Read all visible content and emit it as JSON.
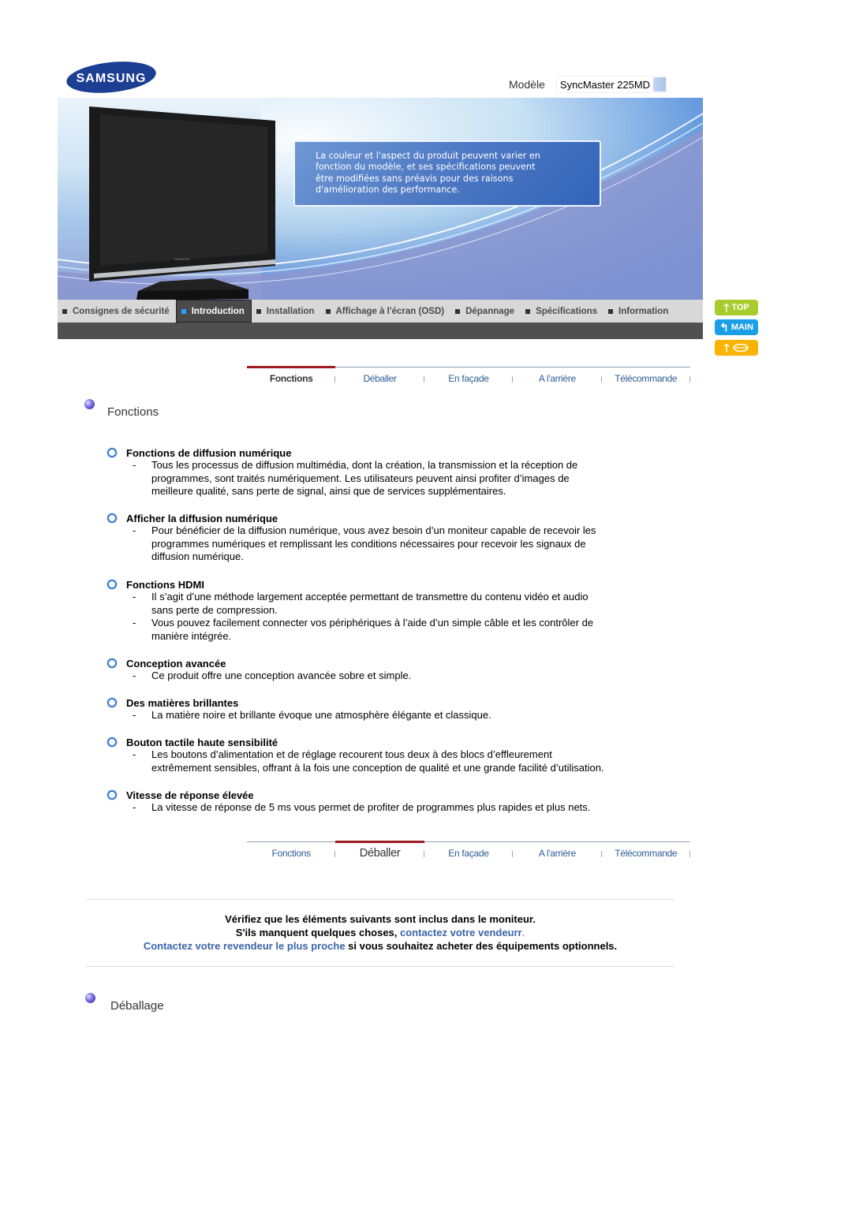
{
  "brand": {
    "logo_text": "SAMSUNG"
  },
  "model": {
    "label": "Modèle",
    "value": "SyncMaster 225MD"
  },
  "banner": {
    "notice_lines": [
      "La couleur et l'aspect du produit peuvent varier en",
      "fonction du modèle, et ses spécifications peuvent",
      "être modifiées sans préavis pour des raisons",
      "d'amélioration des performance."
    ]
  },
  "main_nav": {
    "items": [
      {
        "label": "Consignes de sécurité",
        "active": false
      },
      {
        "label": "Introduction",
        "active": true
      },
      {
        "label": "Installation",
        "active": false
      },
      {
        "label": "Affichage à l'écran (OSD)",
        "active": false
      },
      {
        "label": "Dépannage",
        "active": false
      },
      {
        "label": "Spécifications",
        "active": false
      },
      {
        "label": "Information",
        "active": false
      }
    ]
  },
  "side_buttons": {
    "top": "TOP",
    "main": "MAIN",
    "print_icon": "glasses-icon",
    "colors": {
      "top": "#a8cc2e",
      "main": "#1a9fe6",
      "print": "#f8b400"
    }
  },
  "subtabs_top": {
    "active_index": 0,
    "items": [
      "Fonctions",
      "Déballer",
      "En façade",
      "A l'arrière",
      "Télécommande"
    ]
  },
  "subtabs_bottom": {
    "active_index": 1,
    "items": [
      "Fonctions",
      "Déballer",
      "En façade",
      "A l'arrière",
      "Télécommande"
    ]
  },
  "section_fonctions": {
    "title": "Fonctions",
    "features": [
      {
        "title": "Fonctions de diffusion numérique",
        "items": [
          [
            "Tous les processus de diffusion multimédia, dont la création, la transmission et la réception de",
            "programmes, sont traités numériquement. Les utilisateurs peuvent ainsi profiter d’images de",
            "meilleure qualité, sans perte de signal, ainsi que de services supplémentaires."
          ]
        ]
      },
      {
        "title": "Afficher la diffusion numérique",
        "items": [
          [
            "Pour bénéficier de la diffusion numérique, vous avez besoin d’un moniteur capable de recevoir les",
            "programmes numériques et remplissant les conditions nécessaires pour recevoir les signaux de",
            "diffusion numérique."
          ]
        ]
      },
      {
        "title": "Fonctions HDMI",
        "items": [
          [
            "Il s’agit d’une méthode largement acceptée permettant de transmettre du contenu vidéo et audio",
            "sans perte de compression."
          ],
          [
            "Vous pouvez facilement connecter vos périphériques à l’aide d’un simple câble et les contrôler de",
            "manière intégrée."
          ]
        ]
      },
      {
        "title": "Conception avancée",
        "items": [
          [
            "Ce produit offre une conception avancée sobre et simple."
          ]
        ]
      },
      {
        "title": "Des matières brillantes",
        "items": [
          [
            "La matière noire et brillante évoque une atmosphère élégante et classique."
          ]
        ]
      },
      {
        "title": "Bouton tactile haute sensibilité",
        "items": [
          [
            "Les boutons d’alimentation et de réglage recourent tous deux à des blocs d’effleurement",
            "extrêmement sensibles, offrant à la fois une conception de qualité et une grande facilité d’utilisation."
          ]
        ]
      },
      {
        "title": "Vitesse de réponse élevée",
        "items": [
          [
            "La vitesse de réponse de 5 ms vous permet de profiter de programmes plus rapides et plus nets."
          ]
        ]
      }
    ]
  },
  "unpack_notice": {
    "line1": "Vérifiez que les éléments suivants sont inclus dans le moniteur.",
    "line2_prefix": "S'ils manquent quelques choses, ",
    "line2_link": "contactez votre vendeurr",
    "line2_suffix": ".",
    "line3_link": "Contactez votre revendeur le plus proche",
    "line3_suffix": " si vous souhaitez acheter des équipements optionnels."
  },
  "section_deballage": {
    "title": "Déballage"
  }
}
